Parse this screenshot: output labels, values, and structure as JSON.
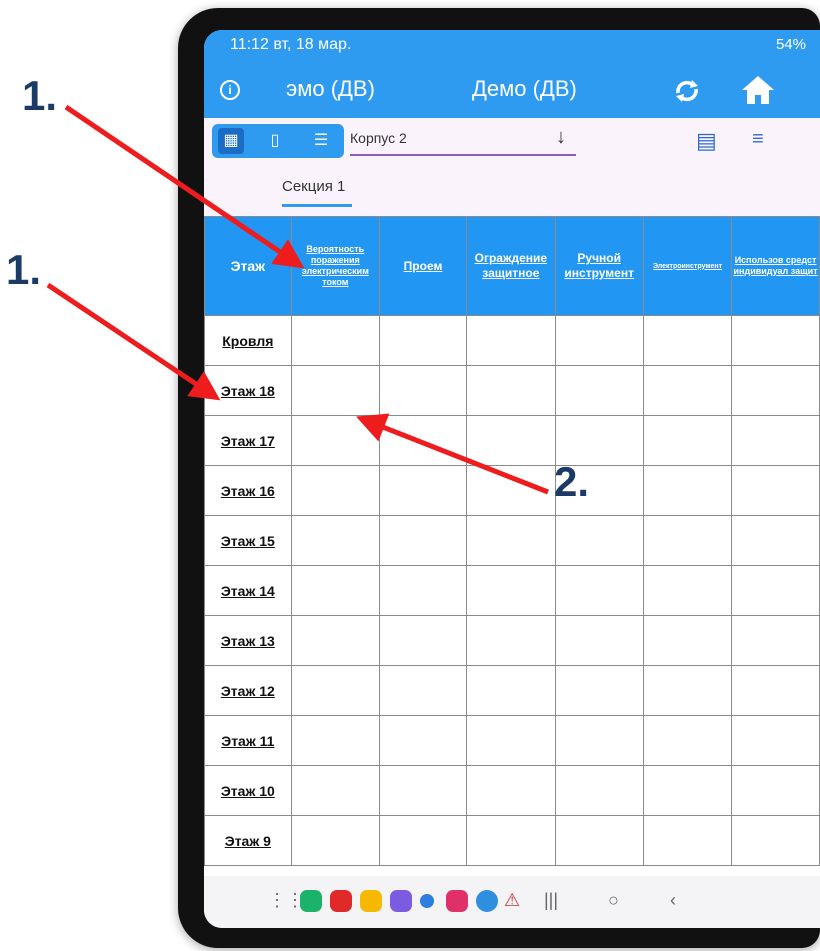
{
  "status_bar": {
    "time": "11:12",
    "date": "вт, 18 мар.",
    "right": "54%"
  },
  "appbar": {
    "title_left": "эмо (ДВ)",
    "title": "Демо (ДВ)",
    "info_icon": "info-icon",
    "sync_icon": "sync-icon",
    "home_icon": "home-icon"
  },
  "toolbar": {
    "korpus": "Корпус 2",
    "tab": "Секция 1"
  },
  "table": {
    "headers": [
      "Этаж",
      "Вероятность поражения электрическим током",
      "Проем",
      "Ограждение защитное",
      "Ручной инструмент",
      "Электроинструмент",
      "Использов средст индивидуал защит"
    ],
    "rows": [
      "Кровля",
      "Этаж 18",
      "Этаж 17",
      "Этаж 16",
      "Этаж 15",
      "Этаж 14",
      "Этаж 13",
      "Этаж 12",
      "Этаж 11",
      "Этаж 10",
      "Этаж 9"
    ]
  },
  "annotations": {
    "label_a": "1.",
    "label_b": "1.",
    "label_c": "2."
  },
  "colors": {
    "primary": "#2e9bf0",
    "header": "#2196f3",
    "arrow": "#ee1c1c"
  }
}
